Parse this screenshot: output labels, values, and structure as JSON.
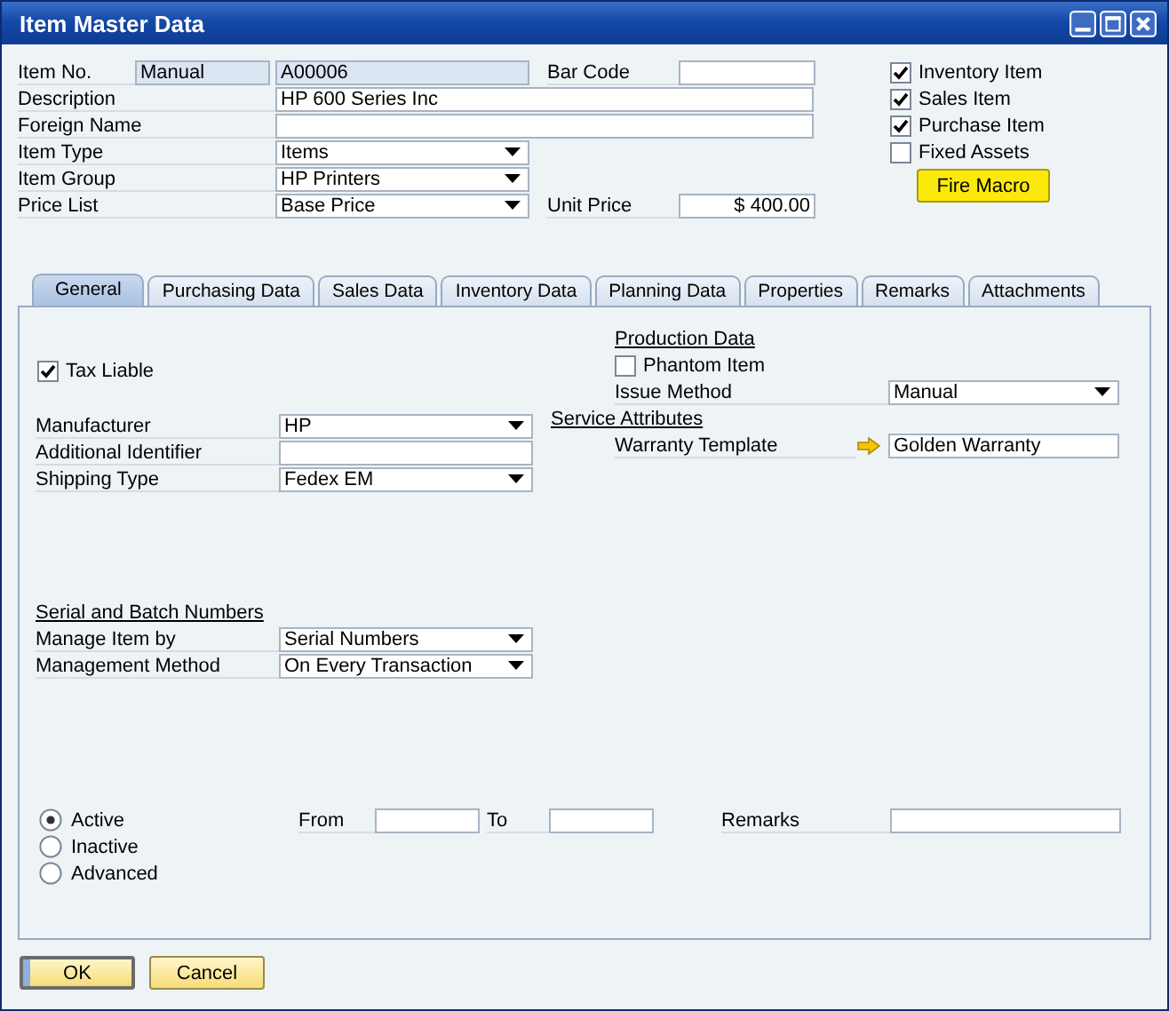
{
  "window": {
    "title": "Item Master Data"
  },
  "header": {
    "rows": [
      {
        "label": "Item No.",
        "kind": "numbered",
        "series": "Manual",
        "value": "A00006",
        "side": {
          "label": "Bar Code"
        }
      },
      {
        "label": "Description",
        "kind": "wide",
        "value": "HP 600 Series Inc"
      },
      {
        "label": "Foreign Name",
        "kind": "wide"
      },
      {
        "label": "Item Type",
        "kind": "dropdown",
        "value": "Items"
      },
      {
        "label": "Item Group",
        "kind": "dropdown",
        "value": "HP Printers"
      },
      {
        "label": "Price List",
        "kind": "dropdown",
        "value": "Base Price",
        "side": {
          "label": "Unit Price",
          "value": "$ 400.00"
        }
      }
    ],
    "checks": [
      {
        "label": "Inventory Item",
        "checked": true
      },
      {
        "label": "Sales Item",
        "checked": true
      },
      {
        "label": "Purchase Item",
        "checked": true
      },
      {
        "label": "Fixed Assets",
        "checked": false
      }
    ],
    "macro_button": "Fire Macro"
  },
  "tabs": [
    {
      "label": "General",
      "selected": true
    },
    {
      "label": "Purchasing Data",
      "selected": false
    },
    {
      "label": "Sales Data",
      "selected": false
    },
    {
      "label": "Inventory Data",
      "selected": false
    },
    {
      "label": "Planning Data",
      "selected": false
    },
    {
      "label": "Properties",
      "selected": false
    },
    {
      "label": "Remarks",
      "selected": false
    },
    {
      "label": "Attachments",
      "selected": false
    }
  ],
  "general": {
    "tax_liable": {
      "label": "Tax Liable",
      "checked": true
    },
    "fields": [
      {
        "label": "Manufacturer",
        "kind": "dropdown",
        "value": "HP"
      },
      {
        "label": "Additional Identifier",
        "kind": "text"
      },
      {
        "label": "Shipping Type",
        "kind": "dropdown",
        "value": "Fedex EM"
      }
    ],
    "production": {
      "heading": "Production Data",
      "phantom": {
        "label": "Phantom Item",
        "checked": false
      },
      "issue_method": {
        "label": "Issue Method",
        "value": "Manual"
      }
    },
    "service": {
      "heading": "Service Attributes",
      "warranty": {
        "label": "Warranty Template",
        "value": "Golden Warranty"
      }
    },
    "serial": {
      "heading": "Serial and Batch Numbers",
      "fields": [
        {
          "label": "Manage Item by",
          "kind": "dropdown",
          "value": "Serial Numbers"
        },
        {
          "label": "Management Method",
          "kind": "dropdown",
          "value": "On Every Transaction"
        }
      ]
    },
    "status": {
      "options": [
        {
          "label": "Active",
          "selected": true
        },
        {
          "label": "Inactive",
          "selected": false
        },
        {
          "label": "Advanced",
          "selected": false
        }
      ],
      "from": "From",
      "to": "To",
      "remarks": "Remarks"
    }
  },
  "buttons": [
    {
      "label": "OK",
      "default": true
    },
    {
      "label": "Cancel",
      "default": false
    }
  ]
}
